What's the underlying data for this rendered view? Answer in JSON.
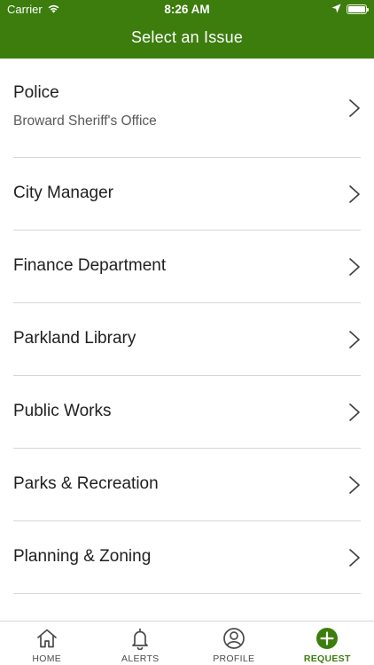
{
  "status_bar": {
    "carrier": "Carrier",
    "time": "8:26 AM",
    "icons": [
      "wifi-icon",
      "location-arrow-icon",
      "battery-icon"
    ]
  },
  "header": {
    "title": "Select an Issue",
    "background_color": "#3c7d0e"
  },
  "issues": [
    {
      "title": "Police",
      "subtitle": "Broward Sheriff's Office"
    },
    {
      "title": "City Manager"
    },
    {
      "title": "Finance Department"
    },
    {
      "title": "Parkland Library"
    },
    {
      "title": "Public Works"
    },
    {
      "title": "Parks & Recreation"
    },
    {
      "title": "Planning & Zoning"
    }
  ],
  "tabbar": {
    "items": [
      {
        "label": "HOME",
        "icon": "home-icon"
      },
      {
        "label": "ALERTS",
        "icon": "bell-icon"
      },
      {
        "label": "PROFILE",
        "icon": "profile-icon"
      },
      {
        "label": "REQUEST",
        "icon": "plus-circle-icon",
        "active": true
      }
    ],
    "active_color": "#3c7d0e"
  }
}
